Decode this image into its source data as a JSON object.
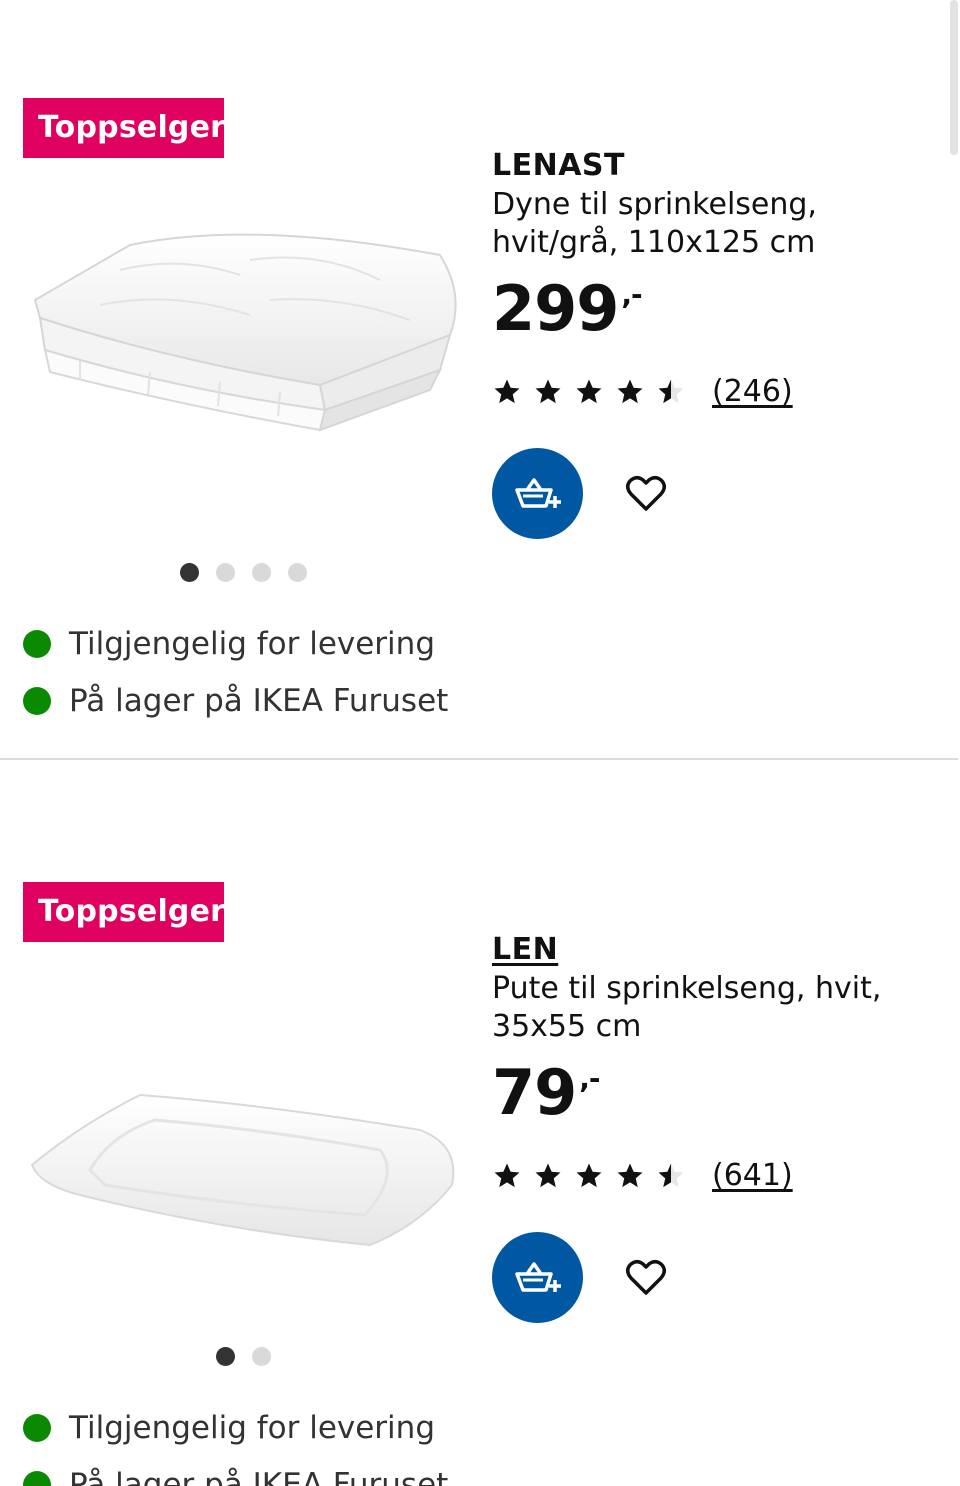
{
  "products": [
    {
      "badge": "Toppselger",
      "name": "LENAST",
      "description": "Dyne til sprinkelseng, hvit/grå, 110x125 cm",
      "price": "299",
      "price_suffix": ",-",
      "rating": 4.5,
      "reviews": "(246)",
      "image_icon": "folded-duvet-image",
      "image_dots": 4,
      "active_dot": 0,
      "availability": [
        "Tilgjengelig for levering",
        "På lager på IKEA Furuset"
      ]
    },
    {
      "badge": "Toppselger",
      "name": "LEN",
      "description": "Pute til sprinkelseng, hvit, 35x55 cm",
      "price": "79",
      "price_suffix": ",-",
      "rating": 4.5,
      "reviews": "(641)",
      "image_icon": "pillow-image",
      "image_dots": 2,
      "active_dot": 0,
      "availability": [
        "Tilgjengelig for levering",
        "På lager på IKEA Furuset"
      ]
    }
  ],
  "colors": {
    "badge": "#e0005f",
    "cart_button": "#0058a3",
    "in_stock": "#0a8a00"
  },
  "icons": {
    "cart": "add-to-cart-icon",
    "favourite": "heart-icon",
    "star": "star-icon"
  }
}
